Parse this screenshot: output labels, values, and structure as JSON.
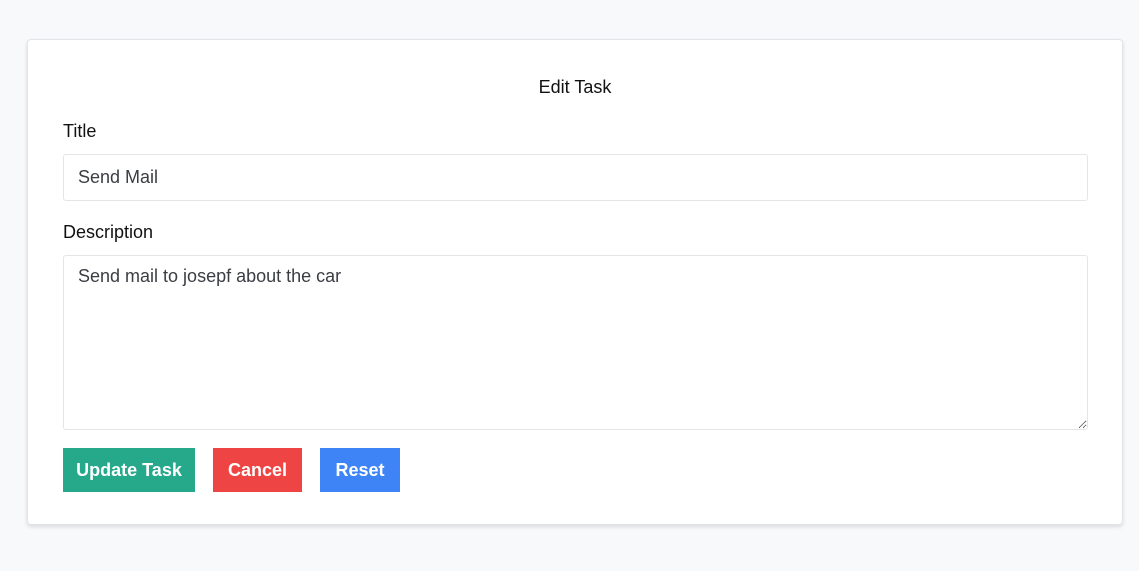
{
  "form": {
    "heading": "Edit Task",
    "title_label": "Title",
    "title_value": "Send Mail",
    "description_label": "Description",
    "description_value": "Send mail to josepf about the car"
  },
  "buttons": {
    "update_label": "Update Task",
    "cancel_label": "Cancel",
    "reset_label": "Reset"
  },
  "colors": {
    "update": "#26a88a",
    "cancel": "#ee4444",
    "reset": "#3f84f6",
    "page_background": "#f8f9fb"
  }
}
